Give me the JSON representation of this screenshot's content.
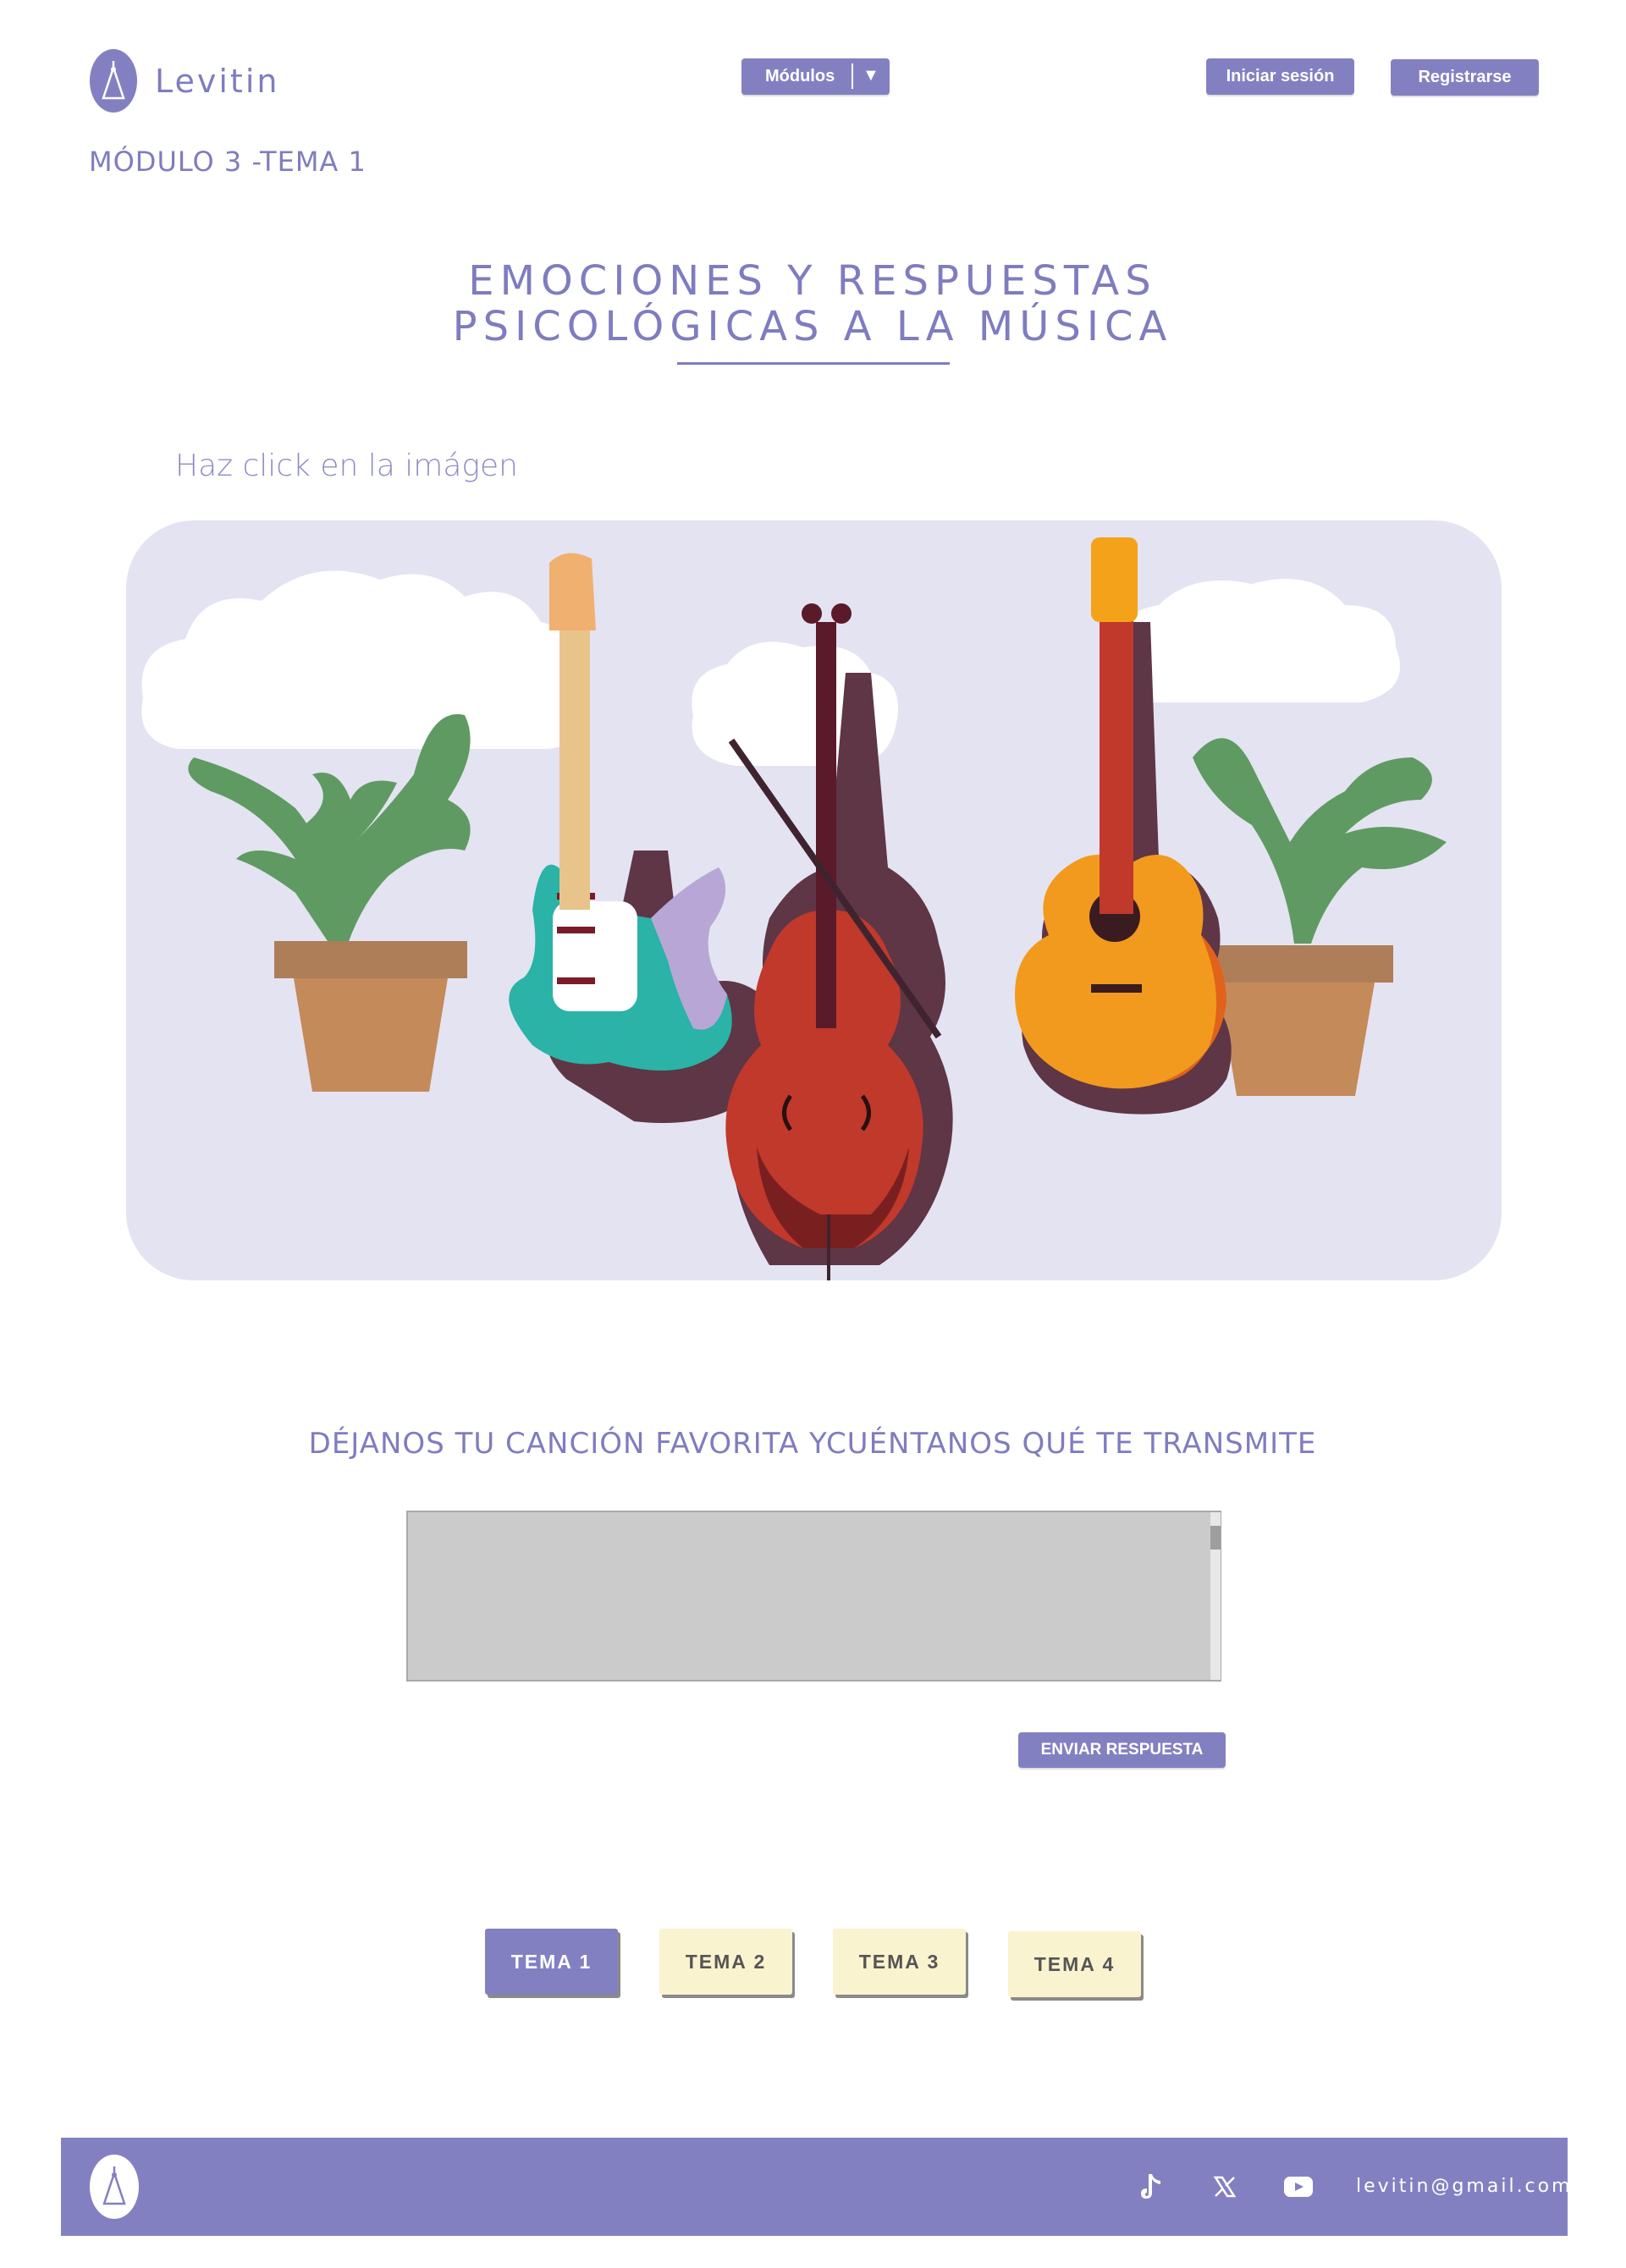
{
  "header": {
    "brand": "Levitin",
    "modules_label": "Módulos",
    "login_label": "Iniciar sesión",
    "register_label": "Registrarse"
  },
  "breadcrumb": "MÓDULO 3 -TEMA 1",
  "page": {
    "title_line1": "EMOCIONES Y RESPUESTAS",
    "title_line2": "PSICOLÓGICAS A LA MÚSICA",
    "hint": "Haz click en la imágen"
  },
  "form": {
    "question": "DÉJANOS TU CANCIÓN FAVORITA YCUÉNTANOS QUÉ TE TRANSMITE",
    "answer_value": "",
    "submit_label": "ENVIAR RESPUESTA"
  },
  "tabs": [
    {
      "label": "TEMA 1",
      "active": true
    },
    {
      "label": "TEMA 2",
      "active": false
    },
    {
      "label": "TEMA 3",
      "active": false
    },
    {
      "label": "TEMA 4",
      "active": false
    }
  ],
  "footer": {
    "email": "levitin@gmail.com",
    "icons": [
      "tiktok-icon",
      "x-icon",
      "youtube-icon"
    ]
  },
  "colors": {
    "accent": "#8380c2",
    "tab_idle": "#faf3cf",
    "illustration_bg": "#e4e3f1"
  }
}
